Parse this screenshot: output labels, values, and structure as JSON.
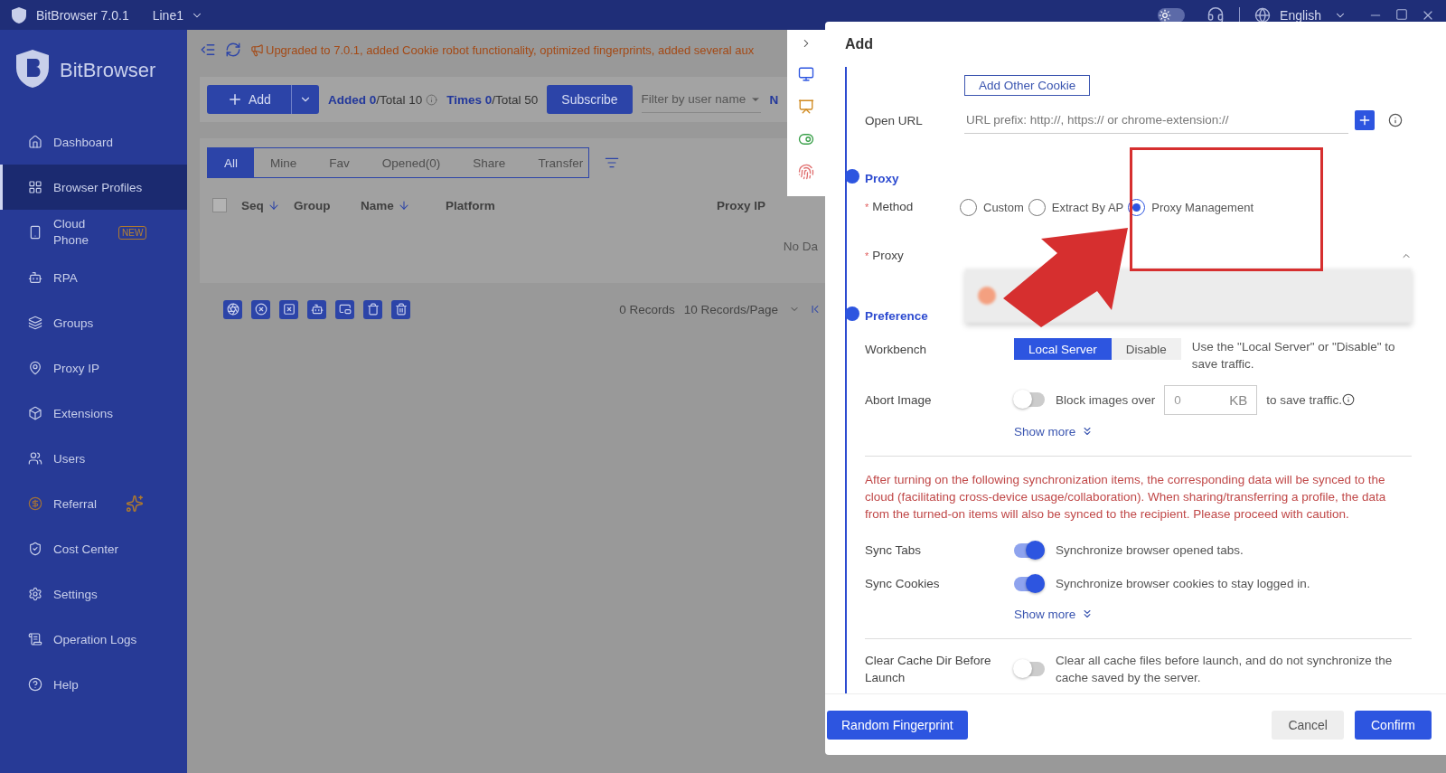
{
  "title_bar": {
    "app_name": "BitBrowser 7.0.1",
    "line": "Line1",
    "dark_mode": false,
    "language": "English"
  },
  "sidebar": {
    "brand": "BitBrowser",
    "items": [
      {
        "label": "Dashboard",
        "selected": false,
        "kind": "plain"
      },
      {
        "label": "Browser Profiles",
        "selected": true,
        "kind": "plain"
      },
      {
        "label": "Cloud Phone",
        "selected": false,
        "kind": "badge",
        "badge": "NEW"
      },
      {
        "label": "RPA",
        "selected": false,
        "kind": "plain"
      },
      {
        "label": "Groups",
        "selected": false,
        "kind": "plain"
      },
      {
        "label": "Proxy IP",
        "selected": false,
        "kind": "plain"
      },
      {
        "label": "Extensions",
        "selected": false,
        "kind": "plain"
      },
      {
        "label": "Users",
        "selected": false,
        "kind": "plain"
      },
      {
        "label": "Referral",
        "selected": false,
        "kind": "promo"
      },
      {
        "label": "Cost Center",
        "selected": false,
        "kind": "plain"
      },
      {
        "label": "Settings",
        "selected": false,
        "kind": "plain"
      },
      {
        "label": "Operation Logs",
        "selected": false,
        "kind": "plain"
      },
      {
        "label": "Help",
        "selected": false,
        "kind": "plain"
      }
    ]
  },
  "main": {
    "select_all_checked": false,
    "announcement": "Upgraded to 7.0.1, added Cookie robot functionality, optimized fingerprints, added several aux",
    "add_button": "Add",
    "added_count": "**Added 0**/Total 10",
    "times_count": "**Times 0**/Total 50",
    "subscribe_button": "Subscribe",
    "user_filter": {
      "placeholder": "Filter by user name"
    },
    "cut_text": "N",
    "tabs": [
      {
        "label": "All",
        "selected": true
      },
      {
        "label": "Mine",
        "selected": false
      },
      {
        "label": "Fav",
        "selected": false
      },
      {
        "label": "Opened(0)",
        "selected": false
      },
      {
        "label": "Share",
        "selected": false
      },
      {
        "label": "Transfer",
        "selected": false
      }
    ],
    "columns": [
      {
        "label": "Seq",
        "sortable": true
      },
      {
        "label": "Group",
        "sortable": false
      },
      {
        "label": "Name",
        "sortable": true
      },
      {
        "label": "Platform",
        "sortable": false
      },
      {
        "label": "Proxy IP",
        "sortable": false
      }
    ],
    "empty_text": "No Da",
    "records": "0 Records",
    "page_size": "10 Records/Page"
  },
  "drawer": {
    "title": "Add",
    "add_cookie_button": "Add Other Cookie",
    "open_url": {
      "label": "Open URL",
      "placeholder": "URL prefix: http://, https:// or chrome-extension://"
    },
    "proxy_section": {
      "heading": "Proxy",
      "method": {
        "label": "Method",
        "required_mark": "*",
        "options": [
          {
            "label": "Custom",
            "selected": false
          },
          {
            "label": "Extract By AP",
            "selected": false
          },
          {
            "label": "Proxy Management",
            "selected": true
          }
        ]
      },
      "proxy": {
        "label": "Proxy",
        "required_mark": "*",
        "expanded": true
      }
    },
    "preference_section": {
      "heading": "Preference",
      "workbench": {
        "label": "Workbench",
        "options": [
          {
            "label": "Local Server",
            "selected": true
          },
          {
            "label": "Disable",
            "selected": false
          }
        ],
        "hint": "Use the \"Local Server\" or \"Disable\" to save traffic."
      },
      "abort_image": {
        "label": "Abort Image",
        "on": false,
        "text_before": "Block images over",
        "value": "0",
        "unit": "KB",
        "text_after": "to save traffic."
      },
      "show_more": "Show more"
    },
    "sync_warning": "After turning on the following synchronization items, the corresponding data will be synced to the cloud (facilitating cross-device usage/collaboration). When sharing/transferring a profile, the data from the turned-on items will also be synced to the recipient. Please proceed with caution.",
    "sync_items": [
      {
        "label": "Sync Tabs",
        "on": true,
        "description": "Synchronize browser opened tabs."
      },
      {
        "label": "Sync Cookies",
        "on": true,
        "description": "Synchronize browser cookies to stay logged in."
      }
    ],
    "sync_show_more": "Show more",
    "clear_cache": {
      "label": "Clear Cache Dir Before Launch",
      "on": false,
      "description": "Clear all cache files before launch, and do not synchronize the cache saved by the server."
    },
    "footer": {
      "random_button": "Random Fingerprint",
      "cancel_button": "Cancel",
      "confirm_button": "Confirm"
    }
  }
}
